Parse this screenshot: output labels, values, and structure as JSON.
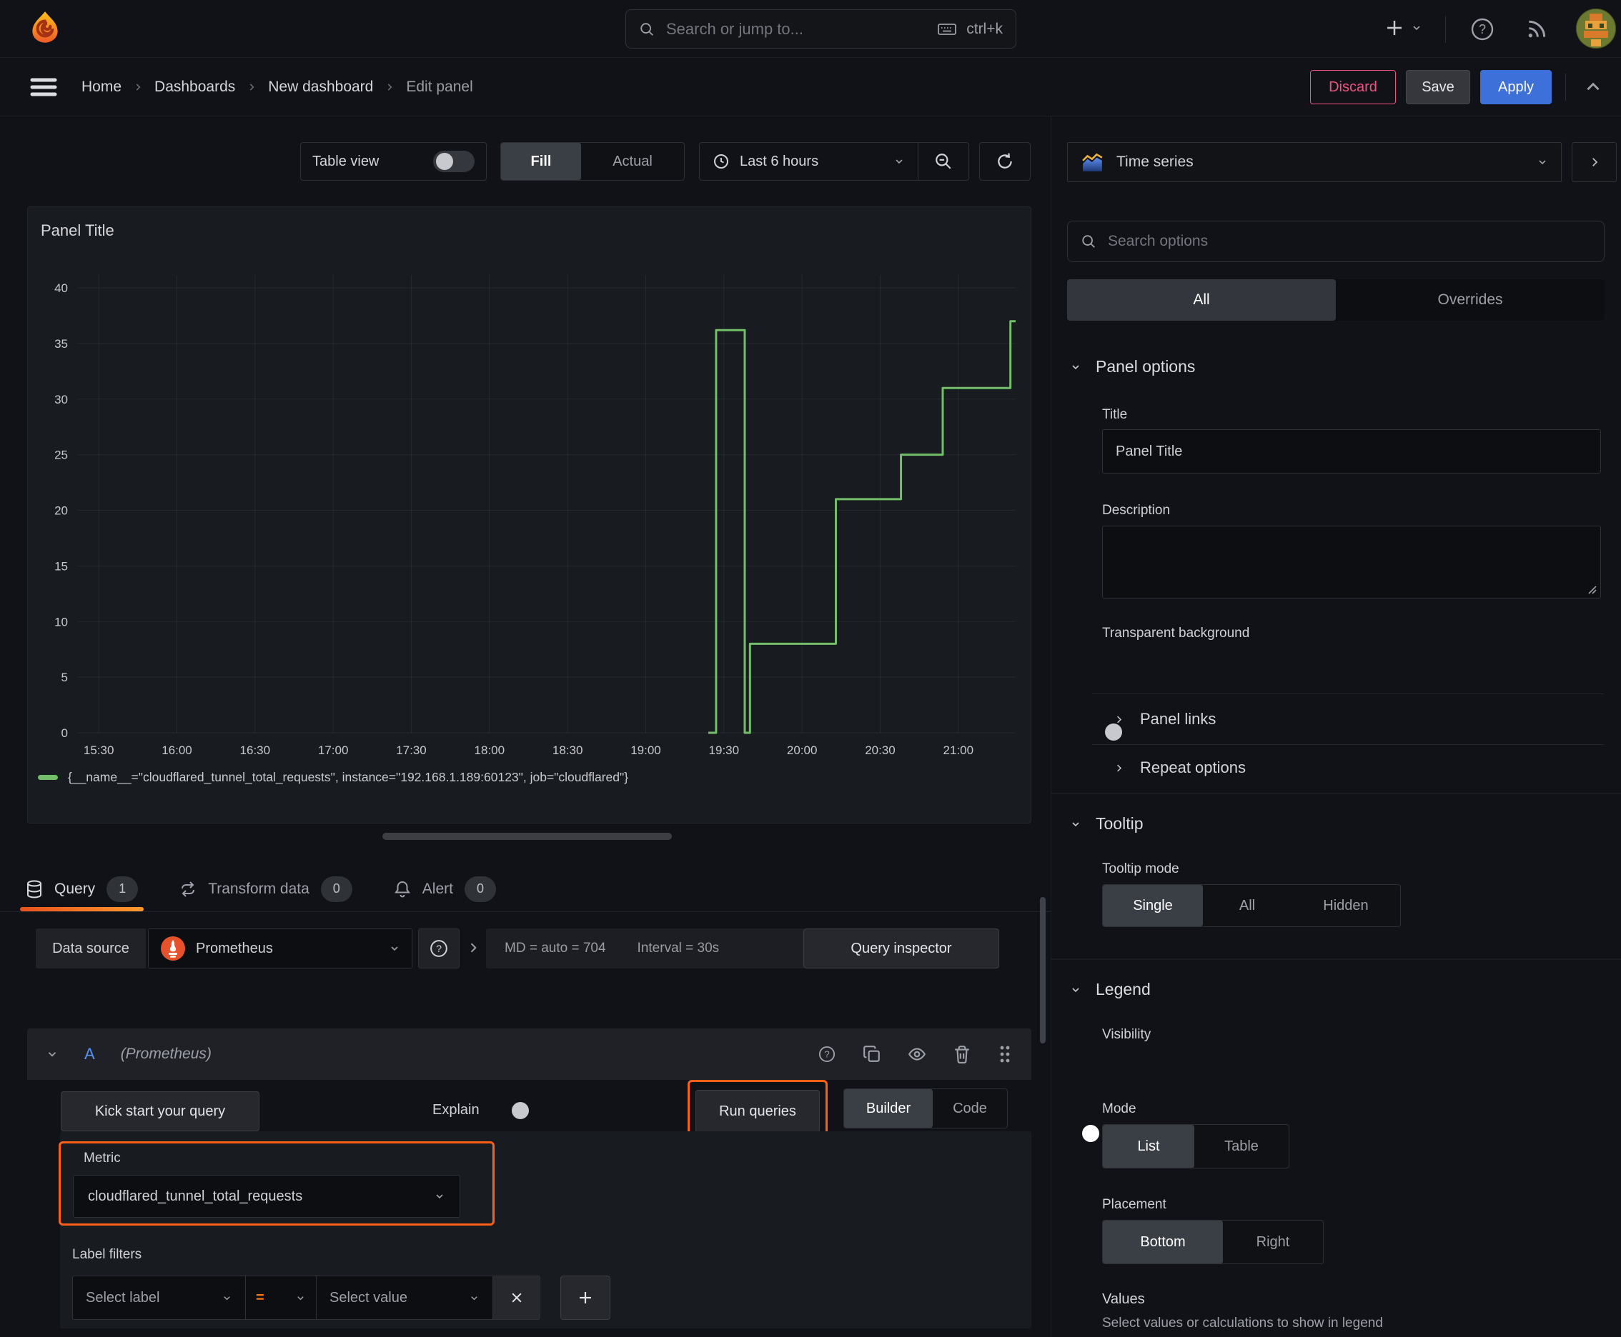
{
  "colors": {
    "accent_orange": "#ff6018",
    "series_green": "#73bf69",
    "primary_blue": "#3d71d9",
    "discard_pink": "#f2527f"
  },
  "topbar": {
    "search_placeholder": "Search or jump to...",
    "shortcut": "ctrl+k"
  },
  "breadcrumb": {
    "items": [
      "Home",
      "Dashboards",
      "New dashboard",
      "Edit panel"
    ],
    "discard": "Discard",
    "save": "Save",
    "apply": "Apply"
  },
  "viewbar": {
    "table_view": "Table view",
    "fill": "Fill",
    "actual": "Actual",
    "time_range": "Last 6 hours"
  },
  "panel": {
    "title": "Panel Title"
  },
  "chart_data": {
    "type": "line",
    "style": "step-after",
    "title": "Panel Title",
    "xlabel": "",
    "ylabel": "",
    "x_range": [
      "15:22",
      "21:22"
    ],
    "ylim": [
      0,
      41
    ],
    "grid": true,
    "legend_position": "bottom",
    "x_ticks": [
      "15:30",
      "16:00",
      "16:30",
      "17:00",
      "17:30",
      "18:00",
      "18:30",
      "19:00",
      "19:30",
      "20:00",
      "20:30",
      "21:00"
    ],
    "y_ticks": [
      0,
      5,
      10,
      15,
      20,
      25,
      30,
      35,
      40
    ],
    "series": [
      {
        "name": "{__name__=\"cloudflared_tunnel_total_requests\", instance=\"192.168.1.189:60123\", job=\"cloudflared\"}",
        "color": "#73bf69",
        "points": [
          [
            "19:24",
            0
          ],
          [
            "19:27",
            36.2
          ],
          [
            "19:38",
            0
          ],
          [
            "19:40",
            8
          ],
          [
            "20:13",
            21
          ],
          [
            "20:38",
            25
          ],
          [
            "20:54",
            31
          ],
          [
            "21:20",
            37
          ]
        ],
        "end_time": "21:22"
      }
    ]
  },
  "tabs": [
    {
      "label": "Query",
      "count": "1"
    },
    {
      "label": "Transform data",
      "count": "0"
    },
    {
      "label": "Alert",
      "count": "0"
    }
  ],
  "datasource": {
    "label": "Data source",
    "name": "Prometheus",
    "stats": "MD = auto = 704",
    "interval": "Interval = 30s",
    "inspector": "Query inspector"
  },
  "query": {
    "ref": "A",
    "datasource_hint": "(Prometheus)",
    "kickstart": "Kick start your query",
    "explain": "Explain",
    "run": "Run queries",
    "builder": "Builder",
    "code": "Code",
    "metric_label": "Metric",
    "metric_value": "cloudflared_tunnel_total_requests",
    "label_filters": "Label filters",
    "select_label": "Select label",
    "operator": "=",
    "select_value": "Select value"
  },
  "sidebar": {
    "visualization": "Time series",
    "search_placeholder": "Search options",
    "tab_all": "All",
    "tab_overrides": "Overrides",
    "panel_options": "Panel options",
    "title_label": "Title",
    "title_value": "Panel Title",
    "description_label": "Description",
    "transparent_bg": "Transparent background",
    "panel_links": "Panel links",
    "repeat_options": "Repeat options",
    "tooltip": "Tooltip",
    "tooltip_mode": "Tooltip mode",
    "tooltip_options": [
      "Single",
      "All",
      "Hidden"
    ],
    "legend": "Legend",
    "visibility": "Visibility",
    "mode": "Mode",
    "mode_options": [
      "List",
      "Table"
    ],
    "placement": "Placement",
    "placement_options": [
      "Bottom",
      "Right"
    ],
    "values_label": "Values",
    "values_desc": "Select values or calculations to show in legend"
  }
}
